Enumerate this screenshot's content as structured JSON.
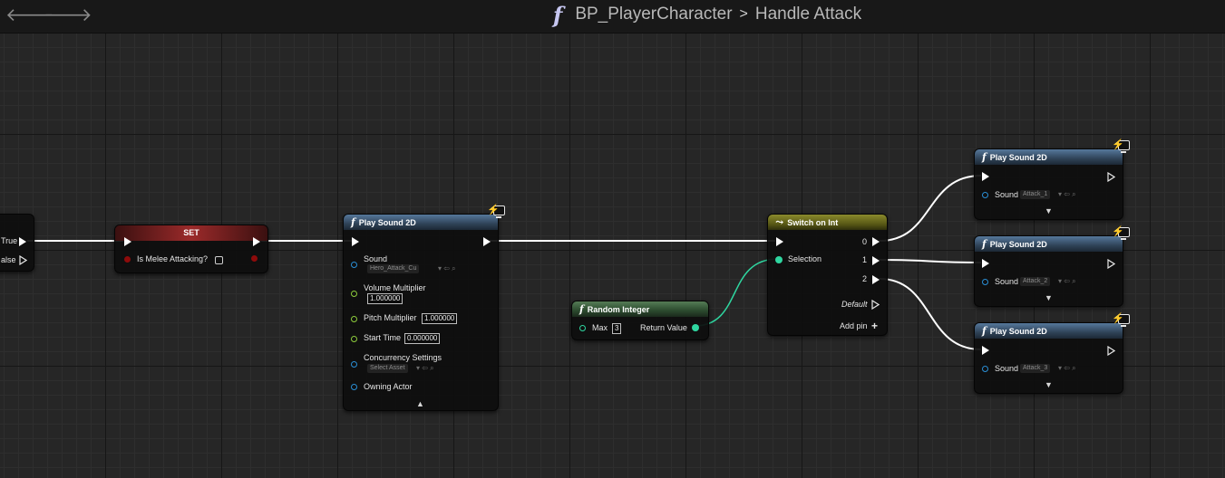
{
  "breadcrumb": {
    "blueprint": "BP_PlayerCharacter",
    "function": "Handle Attack",
    "fn_glyph": "f",
    "separator": ">"
  },
  "nav": {
    "back_icon": "arrow-left-icon",
    "forward_icon": "arrow-right-icon"
  },
  "branch": {
    "true_label": "True",
    "false_label": "alse"
  },
  "set_node": {
    "title": "SET",
    "var_label": "Is Melee Attacking?"
  },
  "play_sound_main": {
    "title": "Play Sound 2D",
    "sound_label": "Sound",
    "sound_value": "Hero_Attack_Cu",
    "volume_label": "Volume Multiplier",
    "volume_value": "1.000000",
    "pitch_label": "Pitch Multiplier",
    "pitch_value": "1.000000",
    "start_label": "Start Time",
    "start_value": "0.000000",
    "concurrency_label": "Concurrency Settings",
    "concurrency_value": "Select Asset",
    "owner_label": "Owning Actor",
    "collapse_glyph": "▲"
  },
  "random_integer": {
    "title": "Random Integer",
    "max_label": "Max",
    "max_value": "3",
    "return_label": "Return Value"
  },
  "switch_node": {
    "title": "Switch on Int",
    "selection_label": "Selection",
    "out0": "0",
    "out1": "1",
    "out2": "2",
    "default_label": "Default",
    "add_pin_label": "Add pin",
    "add_glyph": "+"
  },
  "play_sound_1": {
    "title": "Play Sound 2D",
    "sound_label": "Sound",
    "sound_value": "Attack_1",
    "expand_glyph": "▼"
  },
  "play_sound_2": {
    "title": "Play Sound 2D",
    "sound_label": "Sound",
    "sound_value": "Attack_2",
    "expand_glyph": "▼"
  },
  "play_sound_3": {
    "title": "Play Sound 2D",
    "sound_label": "Sound",
    "sound_value": "Attack_3",
    "expand_glyph": "▼"
  },
  "colors": {
    "object_pin": "#2a8fd6",
    "float_pin": "#8dcc3c",
    "int_pin": "#2fd6a0",
    "bool_pin": "#8e0b0b",
    "set_header": "#9b2a2a",
    "function_header": "#2f4358",
    "pure_header": "#2b4a2e",
    "switch_header": "#5a5a16"
  }
}
